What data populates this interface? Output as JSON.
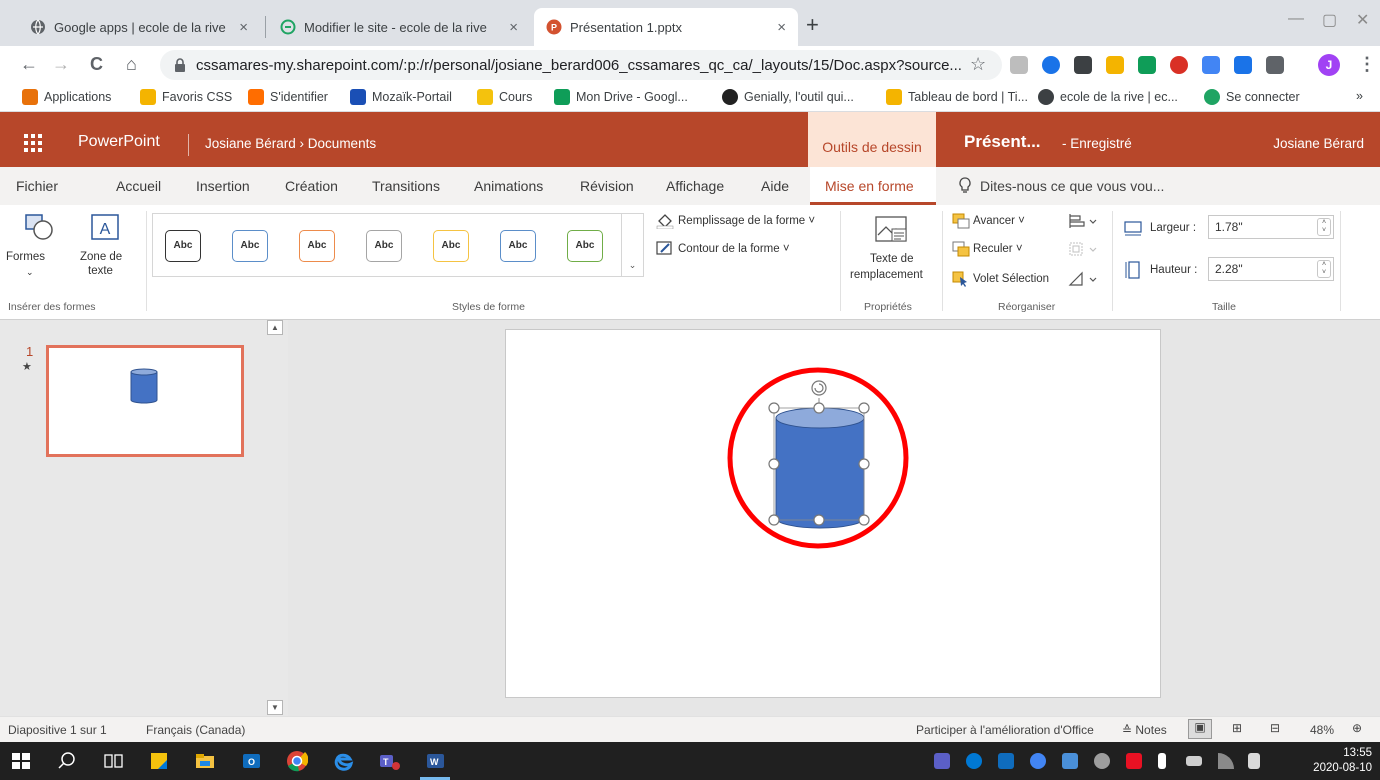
{
  "browser": {
    "tabs": [
      {
        "title": "Google apps | ecole de la rive",
        "close": "×",
        "active": false
      },
      {
        "title": "Modifier le site - ecole de la rive",
        "close": "×",
        "active": false
      },
      {
        "title": "Présentation 1.pptx",
        "close": "×",
        "active": true
      }
    ],
    "new_tab": "+",
    "window_controls": [
      "—",
      "▢",
      "✕"
    ],
    "nav": {
      "back": "←",
      "forward": "→",
      "reload": "C",
      "home": "⌂"
    },
    "url": "cssamares-my.sharepoint.com/:p:/r/personal/josiane_berard006_cssamares_qc_ca/_layouts/15/Doc.aspx?source...",
    "star": "☆",
    "menu": "⋮",
    "profile_initial": "J",
    "bookmarks_more": "»",
    "bookmarks": [
      {
        "label": "Applications",
        "color": "#e8710a"
      },
      {
        "label": "Favoris CSS",
        "color": "#f4b400"
      },
      {
        "label": "S'identifier",
        "color": "#ff6d00"
      },
      {
        "label": "Mozaïk-Portail",
        "color": "#1a4fb5"
      },
      {
        "label": "Cours",
        "color": "#f4c20d"
      },
      {
        "label": "Mon Drive - Googl...",
        "color": "#0f9d58"
      },
      {
        "label": "Genially, l'outil qui...",
        "color": "#222222"
      },
      {
        "label": "Tableau de bord | Ti...",
        "color": "#f4b400"
      },
      {
        "label": "ecole de la rive | ec...",
        "color": "#3c4043"
      },
      {
        "label": "Se connecter",
        "color": "#1fa463"
      }
    ]
  },
  "app": {
    "name": "PowerPoint",
    "breadcrumb": "Josiane Bérard › Documents",
    "contextual_tab": "Outils de dessin",
    "doc_title": "Présent...",
    "doc_status": "-  Enregistré",
    "user": "Josiane Bérard",
    "accent": "#b7472a"
  },
  "ribbon_tabs": [
    "Fichier",
    "Accueil",
    "Insertion",
    "Création",
    "Transitions",
    "Animations",
    "Révision",
    "Affichage",
    "Aide",
    "Mise en forme"
  ],
  "active_tab": "Mise en forme",
  "tell_me": "Dites-nous ce que vous vou...",
  "ribbon": {
    "insert_shapes": {
      "shapes": "Formes",
      "textbox_line1": "Zone de",
      "textbox_line2": "texte",
      "label": "Insérer des formes"
    },
    "shape_styles": {
      "label": "Styles de forme",
      "sample": "Abc",
      "borders": [
        "#333333",
        "#5b8ec9",
        "#ed8b4b",
        "#a5a5a5",
        "#f5c342",
        "#5b8ec9",
        "#70ad47"
      ],
      "fill": "Remplissage de la forme ˅",
      "outline": "Contour de la forme ˅"
    },
    "properties": {
      "alt_line1": "Texte de",
      "alt_line2": "remplacement",
      "label": "Propriétés"
    },
    "arrange": {
      "forward": "Avancer ˅",
      "backward": "Reculer ˅",
      "selection": "Volet Sélection",
      "label": "Réorganiser"
    },
    "size": {
      "width_label": "Largeur :",
      "width_value": "1.78\"",
      "height_label": "Hauteur :",
      "height_value": "2.28\"",
      "label": "Taille"
    }
  },
  "thumbnail": {
    "number": "1",
    "transition_marker": "★"
  },
  "shape": {
    "fill": "#4472c4",
    "top_fill": "#8eaadb",
    "stroke": "#2f528f",
    "annotation": "#ff0000"
  },
  "status": {
    "slide_of": "Diapositive 1 sur 1",
    "language": "Français (Canada)",
    "feedback": "Participer à l'amélioration d'Office",
    "notes": "Notes",
    "zoom": "48%"
  },
  "taskbar": {
    "time": "13:55",
    "date": "2020-08-10"
  }
}
